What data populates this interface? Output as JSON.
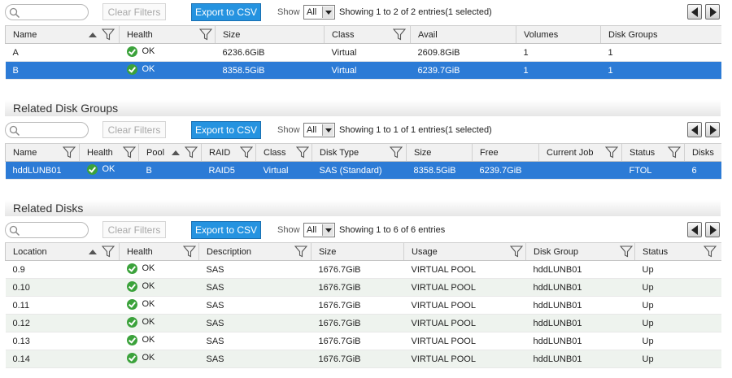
{
  "common": {
    "clear_filters": "Clear Filters",
    "export_csv": "Export to CSV",
    "show_label": "Show",
    "show_value": "All"
  },
  "volumes": {
    "showing": "Showing 1 to 2 of 2 entries(1 selected)",
    "headers": [
      "Name",
      "Health",
      "Size",
      "Class",
      "Avail",
      "Volumes",
      "Disk Groups"
    ],
    "rows": [
      {
        "name": "A",
        "health": "OK",
        "size": "6236.6GiB",
        "class": "Virtual",
        "avail": "2609.8GiB",
        "volumes": "1",
        "disk_groups": "1"
      },
      {
        "name": "B",
        "health": "OK",
        "size": "8358.5GiB",
        "class": "Virtual",
        "avail": "6239.7GiB",
        "volumes": "1",
        "disk_groups": "1"
      }
    ]
  },
  "disk_groups": {
    "title": "Related Disk Groups",
    "showing": "Showing 1 to 1 of 1 entries(1 selected)",
    "headers": [
      "Name",
      "Health",
      "Pool",
      "RAID",
      "Class",
      "Disk Type",
      "Size",
      "Free",
      "Current Job",
      "Status",
      "Disks"
    ],
    "rows": [
      {
        "name": "hddLUNB01",
        "health": "OK",
        "pool": "B",
        "raid": "RAID5",
        "class": "Virtual",
        "disk_type": "SAS (Standard)",
        "size": "8358.5GiB",
        "free": "6239.7GiB",
        "current_job": "",
        "status": "FTOL",
        "disks": "6"
      }
    ]
  },
  "disks": {
    "title": "Related Disks",
    "showing": "Showing 1 to 6 of 6 entries",
    "headers": [
      "Location",
      "Health",
      "Description",
      "Size",
      "Usage",
      "Disk Group",
      "Status"
    ],
    "rows": [
      {
        "location": "0.9",
        "health": "OK",
        "description": "SAS",
        "size": "1676.7GiB",
        "usage": "VIRTUAL POOL",
        "disk_group": "hddLUNB01",
        "status": "Up"
      },
      {
        "location": "0.10",
        "health": "OK",
        "description": "SAS",
        "size": "1676.7GiB",
        "usage": "VIRTUAL POOL",
        "disk_group": "hddLUNB01",
        "status": "Up"
      },
      {
        "location": "0.11",
        "health": "OK",
        "description": "SAS",
        "size": "1676.7GiB",
        "usage": "VIRTUAL POOL",
        "disk_group": "hddLUNB01",
        "status": "Up"
      },
      {
        "location": "0.12",
        "health": "OK",
        "description": "SAS",
        "size": "1676.7GiB",
        "usage": "VIRTUAL POOL",
        "disk_group": "hddLUNB01",
        "status": "Up"
      },
      {
        "location": "0.13",
        "health": "OK",
        "description": "SAS",
        "size": "1676.7GiB",
        "usage": "VIRTUAL POOL",
        "disk_group": "hddLUNB01",
        "status": "Up"
      },
      {
        "location": "0.14",
        "health": "OK",
        "description": "SAS",
        "size": "1676.7GiB",
        "usage": "VIRTUAL POOL",
        "disk_group": "hddLUNB01",
        "status": "Up"
      }
    ]
  },
  "colors": {
    "accent": "#2593e0",
    "selected_row": "#2c7bd6",
    "ok_green": "#3ba23b",
    "alt_row": "#eef3ee"
  },
  "icons": {
    "search": "search-icon",
    "filter": "filter-icon",
    "sort": "sort-ascending-icon",
    "health_ok": "ok-check-icon",
    "prev": "previous-page-icon",
    "next": "next-page-icon"
  }
}
